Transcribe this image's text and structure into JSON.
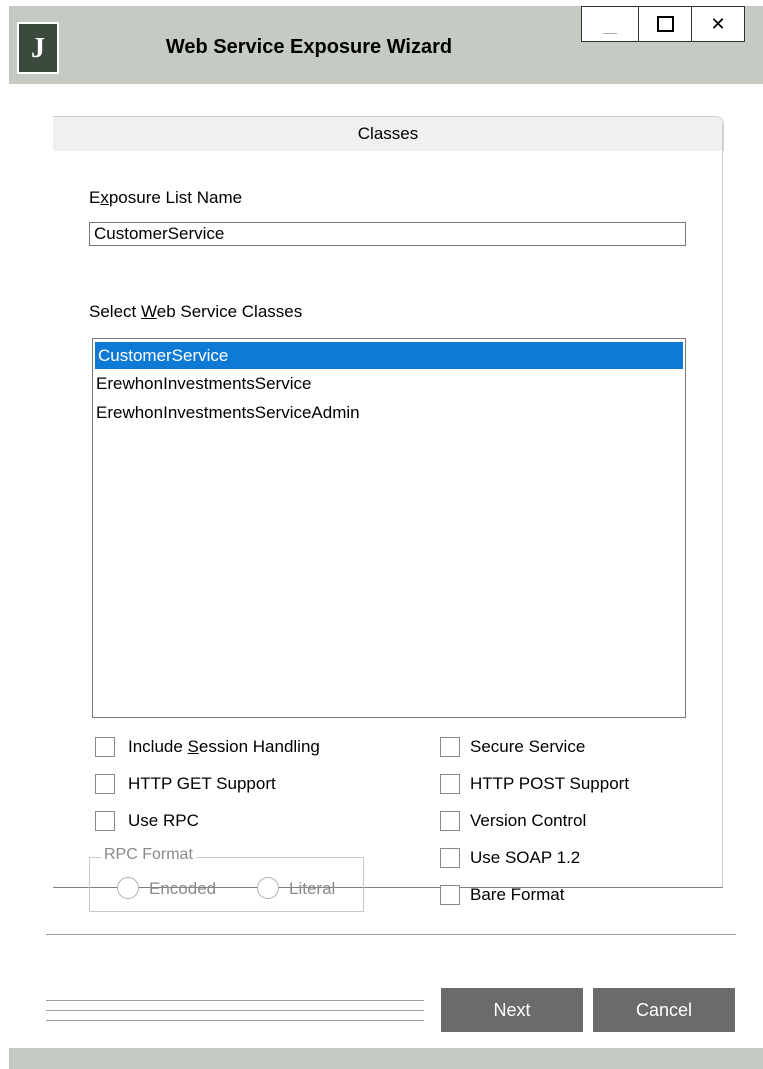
{
  "window": {
    "title": "Web Service Exposure Wizard",
    "logo_letter": "J",
    "minimize_label": "_",
    "close_label": "✕"
  },
  "tab": {
    "label": "Classes"
  },
  "exposure_list": {
    "label": "Exposure List Name",
    "value": "CustomerService"
  },
  "classes": {
    "label": "Select Web Service Classes",
    "items": [
      {
        "label": "CustomerService",
        "selected": true
      },
      {
        "label": "ErewhonInvestmentsService",
        "selected": false
      },
      {
        "label": "ErewhonInvestmentsServiceAdmin",
        "selected": false
      }
    ]
  },
  "options_left": [
    {
      "label": "Include Session Handling",
      "checked": false
    },
    {
      "label": "HTTP GET Support",
      "checked": false
    },
    {
      "label": "Use RPC",
      "checked": false
    }
  ],
  "options_right": [
    {
      "label": "Secure Service",
      "checked": false
    },
    {
      "label": "HTTP POST Support",
      "checked": false
    },
    {
      "label": "Version Control",
      "checked": false
    },
    {
      "label": "Use SOAP 1.2",
      "checked": false
    },
    {
      "label": "Bare Format",
      "checked": false
    }
  ],
  "rpc_format": {
    "label": "RPC Format",
    "options": [
      "Encoded",
      "Literal"
    ]
  },
  "buttons": {
    "next": "Next",
    "cancel": "Cancel"
  },
  "colors": {
    "titlebar": "#c5cac3",
    "selection": "#0f7ad6",
    "button": "#6b6b6b"
  }
}
